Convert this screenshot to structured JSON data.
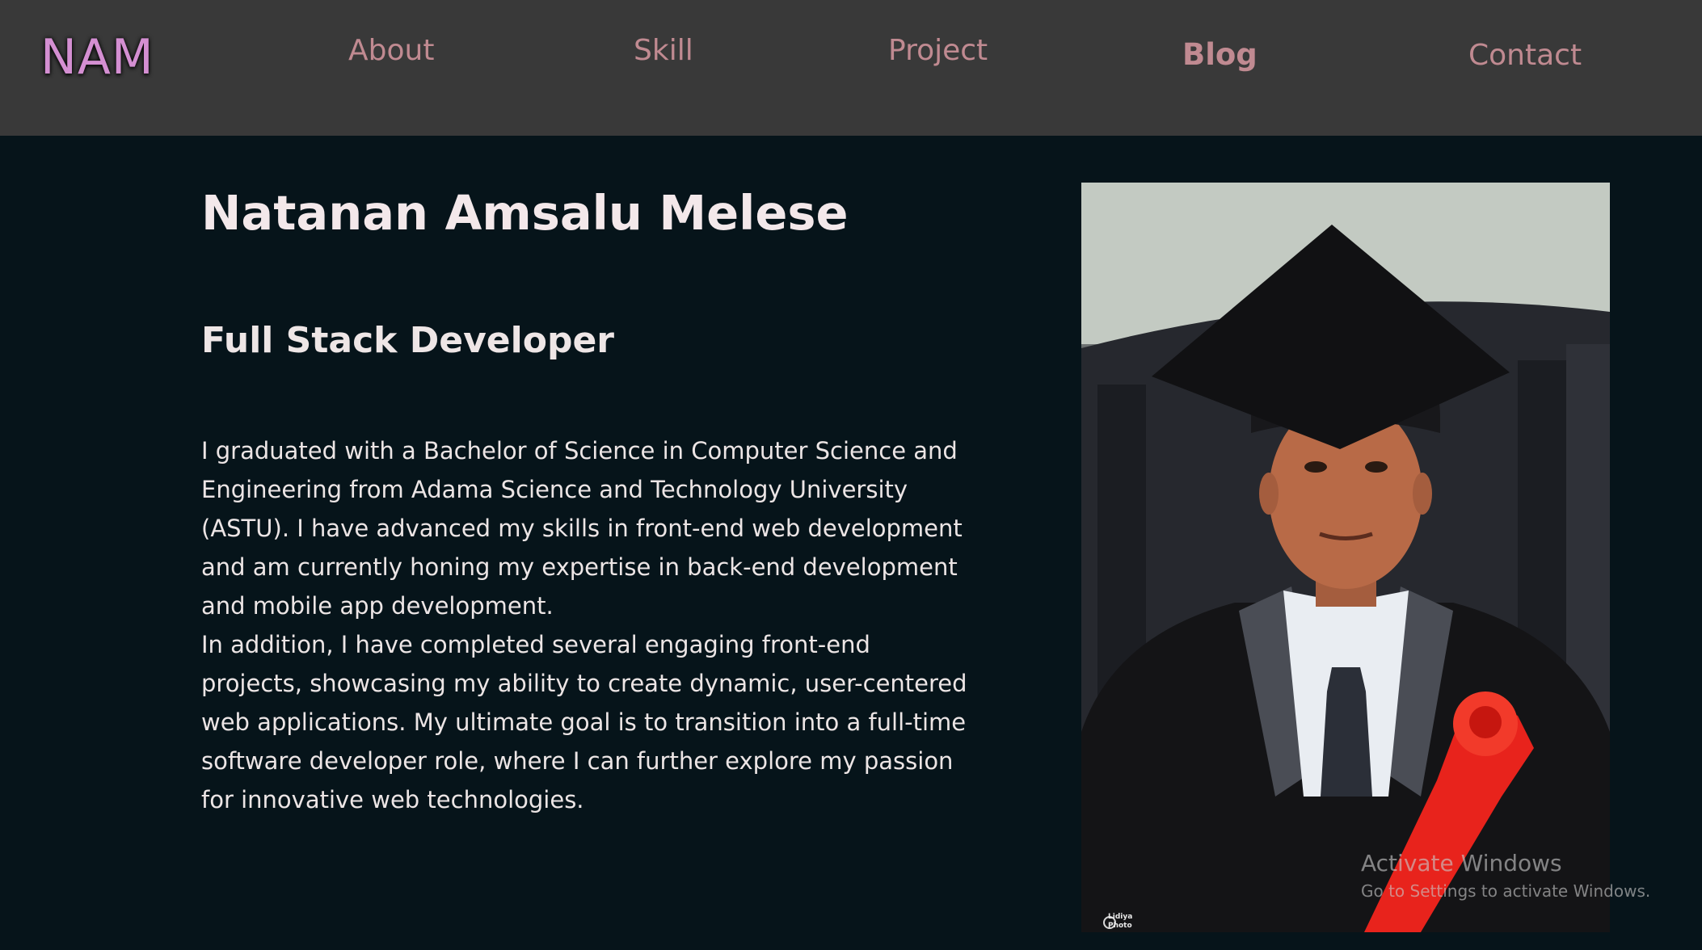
{
  "nav": {
    "logo": "NAM",
    "links": [
      {
        "label": "About"
      },
      {
        "label": "Skill"
      },
      {
        "label": "Project"
      },
      {
        "label": "Blog"
      },
      {
        "label": "Contact"
      }
    ],
    "active": "Blog"
  },
  "hero": {
    "name": "Natanan Amsalu Melese",
    "role": "Full Stack Developer",
    "bio": [
      "I graduated with a Bachelor of Science in Computer Science and Engineering from Adama Science and Technology University (ASTU). I have advanced my skills in front-end web development and am currently honing my expertise in back-end development and mobile app development.",
      "In addition, I have completed several engaging front-end projects, showcasing my ability to create dynamic, user-centered web applications. My ultimate goal is to transition into a full-time software developer role, where I can further explore my passion for innovative web technologies."
    ],
    "photo_credit": [
      "Lidiya",
      "Photo"
    ]
  },
  "watermark": {
    "title": "Activate Windows",
    "subtitle": "Go to Settings to activate Windows."
  },
  "colors": {
    "nav_bg": "#393939",
    "page_bg": "#06141a",
    "logo": "#d48fd2",
    "nav_link": "#c08a91",
    "heading": "#f3e8ea",
    "sash": "#e8231c"
  }
}
